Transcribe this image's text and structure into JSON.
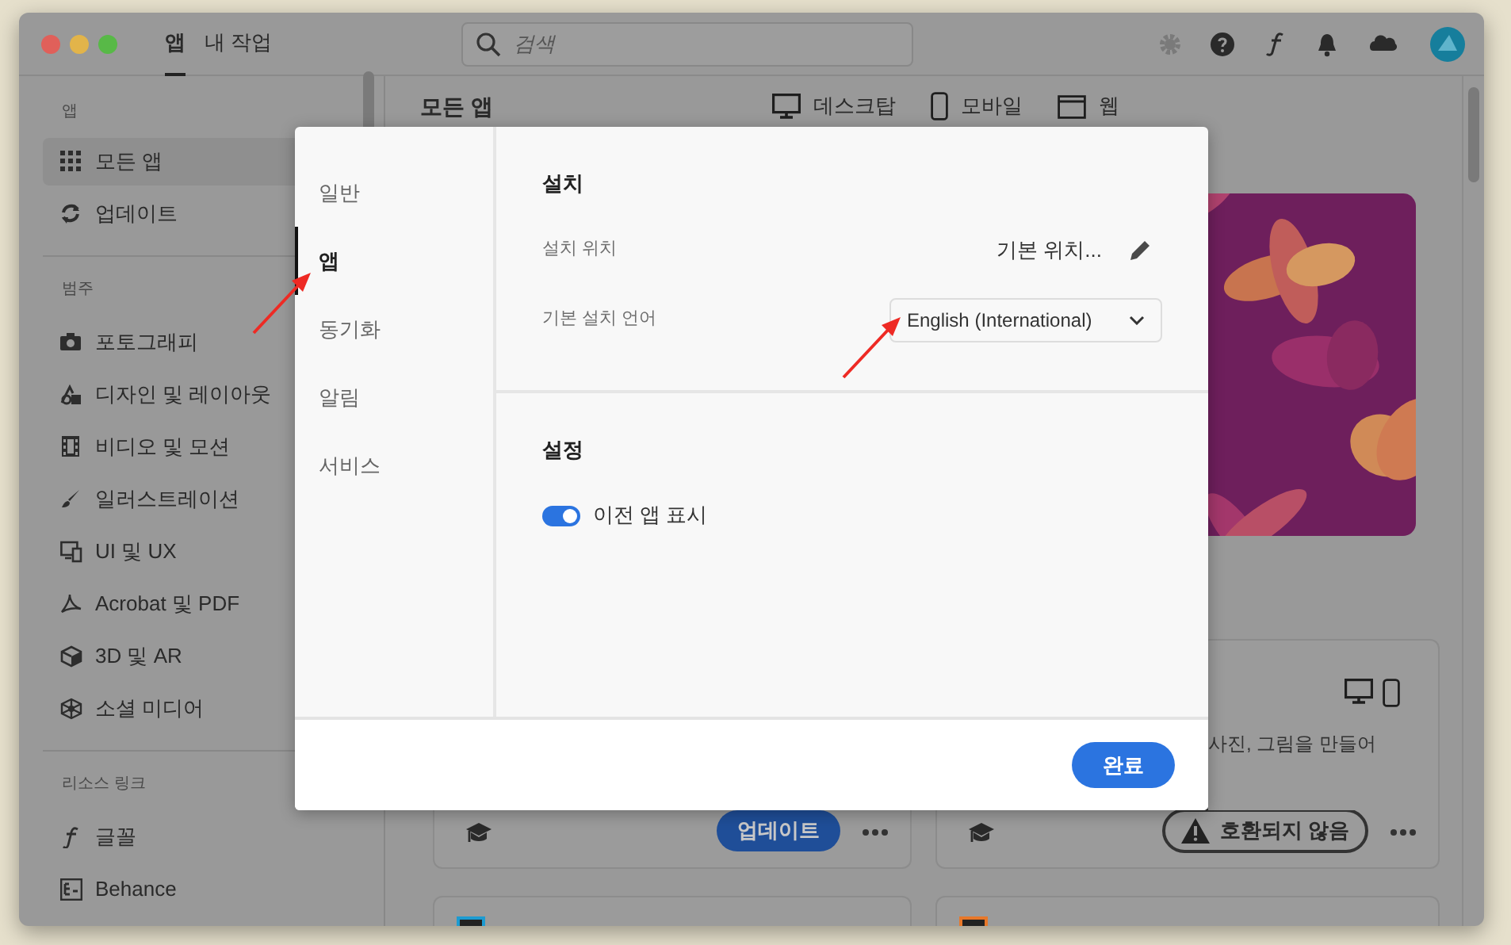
{
  "window": {
    "tabs": [
      {
        "label": "앱",
        "selected": true
      },
      {
        "label": "내 작업",
        "selected": false
      }
    ],
    "search": {
      "placeholder": "검색"
    }
  },
  "sidebar": {
    "sections": [
      {
        "heading": "앱",
        "items": [
          {
            "label": "모든 앱",
            "selected": true
          },
          {
            "label": "업데이트",
            "selected": false
          }
        ]
      },
      {
        "heading": "범주",
        "items": [
          {
            "label": "포토그래피",
            "selected": false
          },
          {
            "label": "디자인 및 레이아웃",
            "selected": false
          },
          {
            "label": "비디오 및 모션",
            "selected": false
          },
          {
            "label": "일러스트레이션",
            "selected": false
          },
          {
            "label": "UI 및 UX",
            "selected": false
          },
          {
            "label": "Acrobat 및 PDF",
            "selected": false
          },
          {
            "label": "3D 및 AR",
            "selected": false
          },
          {
            "label": "소셜 미디어",
            "selected": false
          }
        ]
      },
      {
        "heading": "리소스 링크",
        "items": [
          {
            "label": "글꼴",
            "selected": false
          },
          {
            "label": "Behance",
            "selected": false
          }
        ]
      }
    ]
  },
  "main": {
    "title": "모든 앱",
    "platform_tabs": [
      {
        "label": "데스크탑"
      },
      {
        "label": "모바일"
      },
      {
        "label": "웹"
      }
    ],
    "card": {
      "description": "사진, 그림을 만들어"
    },
    "app_cards": [
      {
        "action": {
          "kind": "update",
          "label": "업데이트"
        }
      },
      {
        "action": {
          "kind": "incompatible",
          "label": "호환되지 않음"
        }
      }
    ],
    "more_cards": [
      {
        "color": "#1d9bd1"
      },
      {
        "color": "#e8782a"
      }
    ]
  },
  "dialog": {
    "nav": [
      {
        "label": "일반",
        "selected": false
      },
      {
        "label": "앱",
        "selected": true
      },
      {
        "label": "동기화",
        "selected": false
      },
      {
        "label": "알림",
        "selected": false
      },
      {
        "label": "서비스",
        "selected": false
      }
    ],
    "sections": [
      {
        "title": "설치",
        "rows": [
          {
            "kind": "value",
            "label": "설치 위치",
            "value": "기본 위치..."
          },
          {
            "kind": "select",
            "label": "기본 설치 언어",
            "value": "English (International)"
          }
        ]
      },
      {
        "title": "설정",
        "rows": [
          {
            "kind": "toggle",
            "label": "이전 앱 표시",
            "on": true
          }
        ]
      }
    ],
    "done_button": "완료"
  },
  "annotations": [
    {
      "kind": "arrow"
    },
    {
      "kind": "arrow"
    }
  ]
}
